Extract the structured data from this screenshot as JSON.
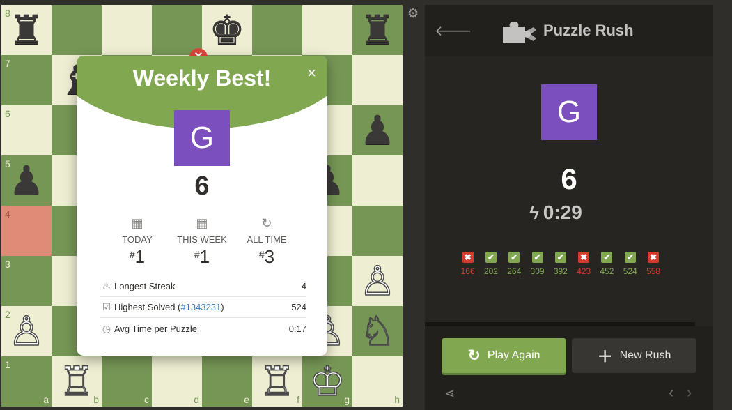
{
  "board": {
    "ranks": [
      "8",
      "7",
      "6",
      "5",
      "4",
      "3",
      "2",
      "1"
    ],
    "files": [
      "a",
      "b",
      "c",
      "d",
      "e",
      "f",
      "g",
      "h"
    ],
    "highlight_square": "a4",
    "pieces": [
      {
        "square": "a8",
        "glyph": "♜",
        "color": "black",
        "name": "black-rook"
      },
      {
        "square": "e8",
        "glyph": "♚",
        "color": "black",
        "name": "black-king"
      },
      {
        "square": "h8",
        "glyph": "♜",
        "color": "black",
        "name": "black-rook"
      },
      {
        "square": "b7",
        "glyph": "♝",
        "color": "black",
        "name": "black-bishop"
      },
      {
        "square": "h6",
        "glyph": "♟",
        "color": "black",
        "name": "black-pawn"
      },
      {
        "square": "a5",
        "glyph": "♟",
        "color": "black",
        "name": "black-pawn"
      },
      {
        "square": "g5",
        "glyph": "♟",
        "color": "black",
        "name": "black-pawn"
      },
      {
        "square": "h3",
        "glyph": "♙",
        "color": "white",
        "name": "white-pawn"
      },
      {
        "square": "a2",
        "glyph": "♙",
        "color": "white",
        "name": "white-pawn"
      },
      {
        "square": "g2",
        "glyph": "♙",
        "color": "white",
        "name": "white-pawn"
      },
      {
        "square": "h2",
        "glyph": "♘",
        "color": "white",
        "name": "white-knight"
      },
      {
        "square": "b1",
        "glyph": "♖",
        "color": "white",
        "name": "white-rook"
      },
      {
        "square": "f1",
        "glyph": "♖",
        "color": "white",
        "name": "white-rook"
      },
      {
        "square": "g1",
        "glyph": "♔",
        "color": "white",
        "name": "white-king"
      }
    ]
  },
  "modal": {
    "title": "Weekly Best!",
    "close_glyph": "×",
    "avatar_letter": "G",
    "score": "6",
    "ranks": [
      {
        "icon": "calendar-icon",
        "glyph": "▦",
        "label": "TODAY",
        "prefix": "#",
        "value": "1"
      },
      {
        "icon": "calendar-icon",
        "glyph": "▦",
        "label": "THIS WEEK",
        "prefix": "#",
        "value": "1"
      },
      {
        "icon": "refresh-icon",
        "glyph": "↻",
        "label": "ALL TIME",
        "prefix": "#",
        "value": "3"
      }
    ],
    "stats": {
      "streak": {
        "glyph": "♨",
        "label": "Longest Streak",
        "value": "4"
      },
      "highest": {
        "glyph": "☑",
        "label_before": "Highest Solved (",
        "link": "#1343231",
        "label_after": ")",
        "value": "524"
      },
      "avg": {
        "glyph": "◷",
        "label": "Avg Time per Puzzle",
        "value": "0:17"
      }
    }
  },
  "panel": {
    "title": "Puzzle Rush",
    "avatar_letter": "G",
    "score": "6",
    "timer": "0:29",
    "bolt_glyph": "ϟ",
    "results": [
      {
        "status": "bad",
        "value": "166"
      },
      {
        "status": "ok",
        "value": "202"
      },
      {
        "status": "ok",
        "value": "264"
      },
      {
        "status": "ok",
        "value": "309"
      },
      {
        "status": "ok",
        "value": "392"
      },
      {
        "status": "bad",
        "value": "423"
      },
      {
        "status": "ok",
        "value": "452"
      },
      {
        "status": "ok",
        "value": "524"
      },
      {
        "status": "bad",
        "value": "558"
      }
    ],
    "play_again_label": "Play Again",
    "new_rush_label": "New Rush"
  },
  "colors": {
    "light_square": "#eeeed2",
    "dark_square": "#769656",
    "highlight": "#e08a78",
    "accent_green": "#81a751",
    "avatar_purple": "#7b4fbe",
    "error_red": "#d33b2f"
  }
}
